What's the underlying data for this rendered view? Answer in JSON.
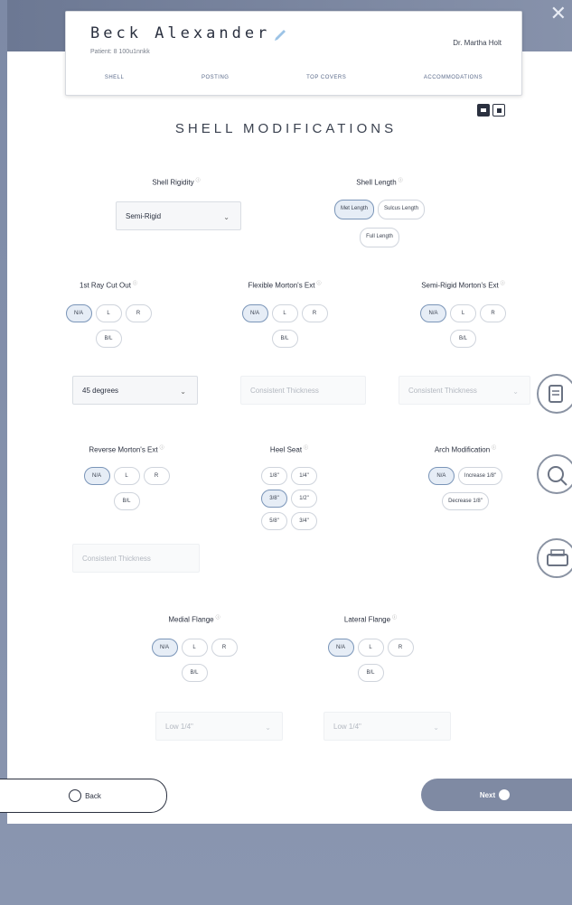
{
  "header": {
    "patient_name": "Beck Alexander",
    "patient_id": "Patient: 8 100u1nnkk",
    "doctor": "Dr. Martha Holt",
    "tabs": [
      "SHELL",
      "POSTING",
      "TOP COVERS",
      "ACCOMMODATIONS"
    ]
  },
  "section_title": "SHELL MODIFICATIONS",
  "shell_rigidity": {
    "label": "Shell Rigidity",
    "value": "Semi-Rigid"
  },
  "shell_length": {
    "label": "Shell Length",
    "options": [
      "Met Length",
      "Sulcus Length",
      "Full Length"
    ],
    "selected": "Met Length"
  },
  "first_ray": {
    "label": "1st Ray Cut Out",
    "options": [
      "N/A",
      "L",
      "R",
      "B/L"
    ],
    "selected": "N/A",
    "select_value": "45 degrees"
  },
  "flexible_morton": {
    "label": "Flexible Morton's Ext",
    "options": [
      "N/A",
      "L",
      "R",
      "B/L"
    ],
    "selected": "N/A",
    "select_value": "Consistent Thickness"
  },
  "semirigid_morton": {
    "label": "Semi-Rigid Morton's Ext",
    "options": [
      "N/A",
      "L",
      "R",
      "B/L"
    ],
    "selected": "N/A",
    "select_value": "Consistent Thickness"
  },
  "reverse_morton": {
    "label": "Reverse Morton's Ext",
    "options": [
      "N/A",
      "L",
      "R",
      "B/L"
    ],
    "selected": "N/A",
    "select_value": "Consistent Thickness"
  },
  "heel_seat": {
    "label": "Heel Seat",
    "options": [
      "1/8\"",
      "1/4\"",
      "3/8\"",
      "1/2\"",
      "5/8\"",
      "3/4\""
    ],
    "selected": "3/8\""
  },
  "arch_mod": {
    "label": "Arch Modification",
    "options": [
      "N/A",
      "Increase 1/8\"",
      "Decrease 1/8\""
    ],
    "selected": "N/A"
  },
  "medial_flange": {
    "label": "Medial Flange",
    "options": [
      "N/A",
      "L",
      "R",
      "B/L"
    ],
    "selected": "N/A",
    "select_value": "Low 1/4\""
  },
  "lateral_flange": {
    "label": "Lateral Flange",
    "options": [
      "N/A",
      "L",
      "R",
      "B/L"
    ],
    "selected": "N/A",
    "select_value": "Low 1/4\""
  },
  "buttons": {
    "back": "Back",
    "next": "Next"
  },
  "icons": [
    "edit-icon",
    "clipboard-icon",
    "scan-icon",
    "printer-icon",
    "close-icon"
  ],
  "colors": {
    "accent": "#7a95b8",
    "next_button": "#7f8aa3",
    "text": "#2b3140"
  }
}
